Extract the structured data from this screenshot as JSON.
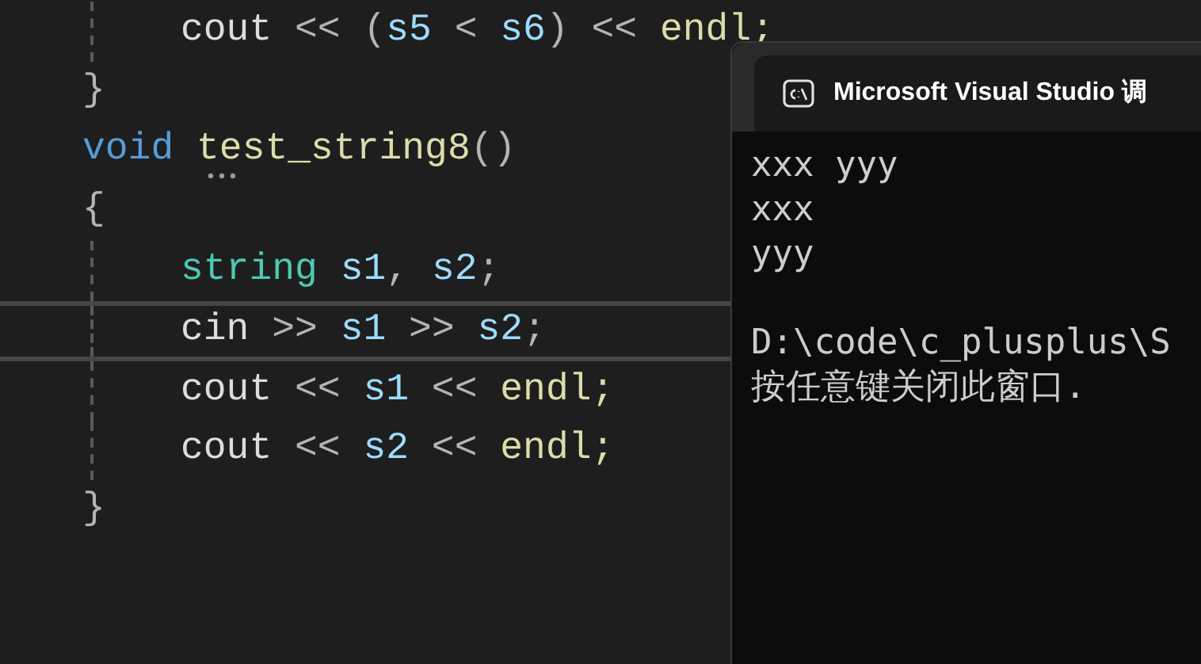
{
  "code_lines": [
    {
      "indented": true,
      "current": false,
      "tokens": [
        {
          "text": "cout",
          "kind": "plain"
        },
        {
          "text": " << (",
          "kind": "op"
        },
        {
          "text": "s5",
          "kind": "var"
        },
        {
          "text": " < ",
          "kind": "op"
        },
        {
          "text": "s6",
          "kind": "var"
        },
        {
          "text": ") << ",
          "kind": "op"
        },
        {
          "text": "endl;",
          "kind": "func"
        }
      ]
    },
    {
      "indented": false,
      "current": false,
      "tokens": [
        {
          "text": "}",
          "kind": "op"
        }
      ]
    },
    {
      "indented": false,
      "current": false,
      "hint": true,
      "tokens": [
        {
          "text": "void ",
          "kind": "keyword"
        },
        {
          "text": "test_string8",
          "kind": "func"
        },
        {
          "text": "()",
          "kind": "op"
        }
      ]
    },
    {
      "indented": false,
      "current": false,
      "tokens": [
        {
          "text": "{",
          "kind": "op"
        }
      ]
    },
    {
      "indented": true,
      "current": false,
      "tokens": [
        {
          "text": "string ",
          "kind": "type"
        },
        {
          "text": "s1",
          "kind": "var"
        },
        {
          "text": ", ",
          "kind": "op"
        },
        {
          "text": "s2",
          "kind": "var"
        },
        {
          "text": ";",
          "kind": "op"
        }
      ]
    },
    {
      "indented": true,
      "current": true,
      "tokens": [
        {
          "text": "cin",
          "kind": "plain"
        },
        {
          "text": " >> ",
          "kind": "op"
        },
        {
          "text": "s1",
          "kind": "var"
        },
        {
          "text": " >> ",
          "kind": "op"
        },
        {
          "text": "s2",
          "kind": "var"
        },
        {
          "text": ";",
          "kind": "op"
        }
      ]
    },
    {
      "indented": true,
      "current": false,
      "tokens": [
        {
          "text": "cout",
          "kind": "plain"
        },
        {
          "text": " << ",
          "kind": "op"
        },
        {
          "text": "s1",
          "kind": "var"
        },
        {
          "text": " << ",
          "kind": "op"
        },
        {
          "text": "endl;",
          "kind": "func"
        }
      ]
    },
    {
      "indented": true,
      "current": false,
      "tokens": [
        {
          "text": "cout",
          "kind": "plain"
        },
        {
          "text": " << ",
          "kind": "op"
        },
        {
          "text": "s2",
          "kind": "var"
        },
        {
          "text": " << ",
          "kind": "op"
        },
        {
          "text": "endl;",
          "kind": "func"
        }
      ]
    },
    {
      "indented": false,
      "current": false,
      "tokens": [
        {
          "text": "}",
          "kind": "op"
        }
      ]
    }
  ],
  "console": {
    "title": "Microsoft Visual Studio 调",
    "blocks": [
      [
        "xxx yyy",
        "xxx",
        "yyy"
      ],
      [
        "D:\\code\\c_plusplus\\S",
        "按任意键关闭此窗口."
      ]
    ]
  }
}
